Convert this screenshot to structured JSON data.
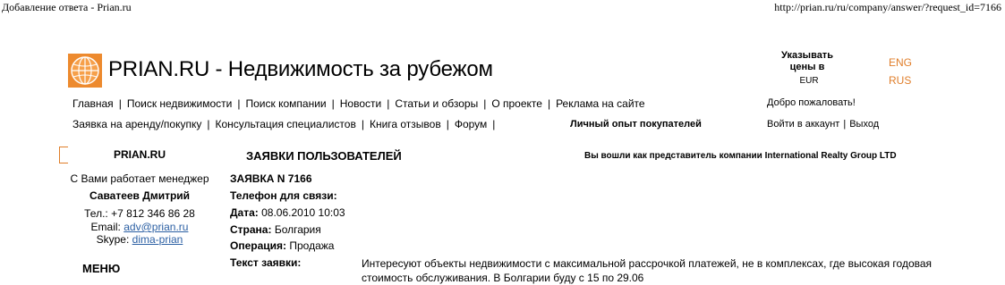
{
  "print_header": {
    "title": "Добавление ответа - Prian.ru",
    "url": "http://prian.ru/ru/company/answer/?request_id=7166"
  },
  "header": {
    "site_title": "PRIAN.RU - Недвижимость за рубежом",
    "currency_label": "Указывать цены в",
    "currency_value": "EUR",
    "lang_eng": "ENG",
    "lang_rus": "RUS",
    "welcome": "Добро пожаловать!",
    "login": "Войти в аккаунт",
    "logout": "Выход"
  },
  "nav_row1": [
    "Главная",
    "Поиск недвижимости",
    "Поиск компании",
    "Новости",
    "Статьи и обзоры",
    "О проекте",
    "Реклама на сайте"
  ],
  "nav_row2": [
    "Заявка на аренду/покупку",
    "Консультация специалистов",
    "Книга отзывов",
    "Форум"
  ],
  "nav_buyer_experience": "Личный опыт покупателей",
  "sidebar": {
    "title": "PRIAN.RU",
    "manager_intro": "С Вами работает менеджер",
    "manager_name": "Саватеев Дмитрий",
    "phone": "Тел.: +7 812 346 86 28",
    "email_label": "Email:",
    "email": "adv@prian.ru",
    "skype_label": "Skype:",
    "skype": "dima-prian",
    "menu_title": "МЕНЮ"
  },
  "content": {
    "title": "ЗАЯВКИ ПОЛЬЗОВАТЕЛЕЙ",
    "logged_in_as": "Вы вошли как представитель компании International Realty Group LTD",
    "request_no": "ЗАЯВКА N 7166",
    "phone_label": "Телефон для связи:",
    "date_label": "Дата:",
    "date_value": "08.06.2010 10:03",
    "country_label": "Страна:",
    "country_value": "Болгария",
    "operation_label": "Операция:",
    "operation_value": "Продажа",
    "text_label": "Текст заявки:",
    "text_value": "Интересуют объекты недвижимости с максимальной рассрочкой платежей, не в комплексах, где высокая годовая стоимость обслуживания. В Болгарии буду с 15 по 29.06"
  },
  "colors": {
    "accent_orange": "#e07e2a",
    "link_blue": "#2b5fa3"
  }
}
